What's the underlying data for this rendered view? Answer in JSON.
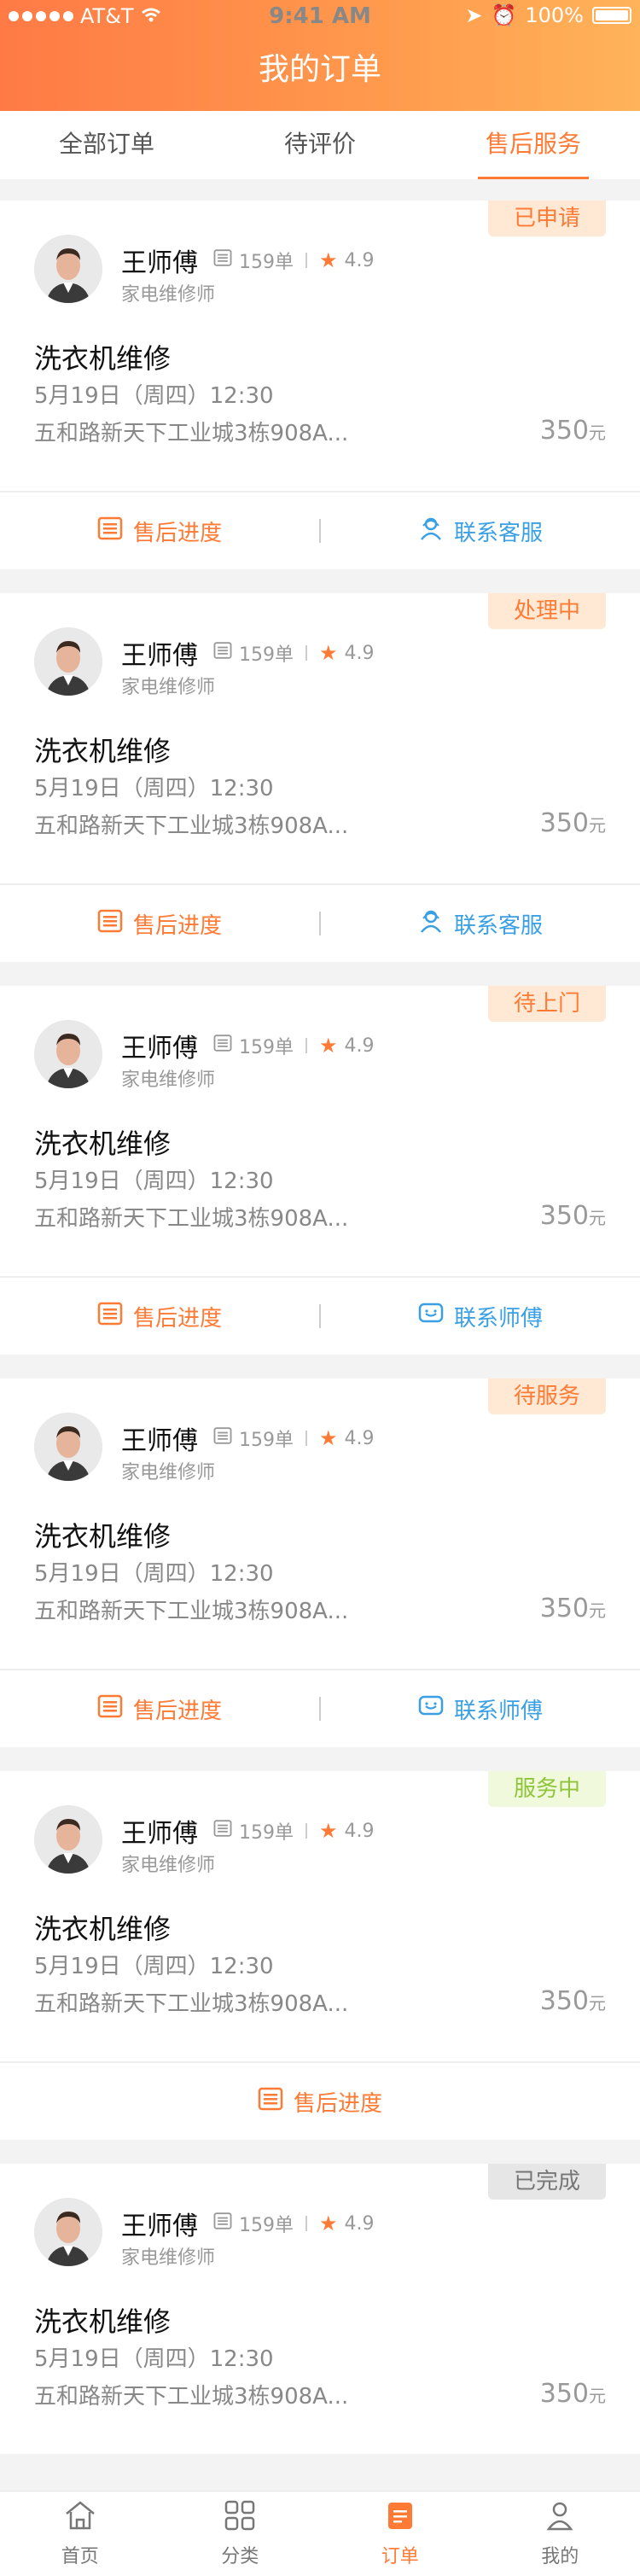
{
  "status_bar": {
    "carrier": "AT&T",
    "time": "9:41 AM",
    "battery": "100%"
  },
  "header": {
    "title": "我的订单"
  },
  "tabs": [
    {
      "label": "全部订单"
    },
    {
      "label": "待评价"
    },
    {
      "label": "售后服务"
    }
  ],
  "cards": [
    {
      "badge": "已申请",
      "name": "王师傅",
      "orders": "159单",
      "rating": "4.9",
      "role": "家电维修师",
      "service": "洗衣机维修",
      "datetime": "5月19日（周四）12:30",
      "address": "五和路新天下工业城3栋908A...",
      "price": "350",
      "unit": "元",
      "actions": [
        {
          "label": "售后进度"
        },
        {
          "label": "联系客服"
        }
      ]
    },
    {
      "badge": "处理中",
      "name": "王师傅",
      "orders": "159单",
      "rating": "4.9",
      "role": "家电维修师",
      "service": "洗衣机维修",
      "datetime": "5月19日（周四）12:30",
      "address": "五和路新天下工业城3栋908A...",
      "price": "350",
      "unit": "元",
      "actions": [
        {
          "label": "售后进度"
        },
        {
          "label": "联系客服"
        }
      ]
    },
    {
      "badge": "待上门",
      "name": "王师傅",
      "orders": "159单",
      "rating": "4.9",
      "role": "家电维修师",
      "service": "洗衣机维修",
      "datetime": "5月19日（周四）12:30",
      "address": "五和路新天下工业城3栋908A...",
      "price": "350",
      "unit": "元",
      "actions": [
        {
          "label": "售后进度"
        },
        {
          "label": "联系师傅"
        }
      ]
    },
    {
      "badge": "待服务",
      "name": "王师傅",
      "orders": "159单",
      "rating": "4.9",
      "role": "家电维修师",
      "service": "洗衣机维修",
      "datetime": "5月19日（周四）12:30",
      "address": "五和路新天下工业城3栋908A...",
      "price": "350",
      "unit": "元",
      "actions": [
        {
          "label": "售后进度"
        },
        {
          "label": "联系师傅"
        }
      ]
    },
    {
      "badge": "服务中",
      "name": "王师傅",
      "orders": "159单",
      "rating": "4.9",
      "role": "家电维修师",
      "service": "洗衣机维修",
      "datetime": "5月19日（周四）12:30",
      "address": "五和路新天下工业城3栋908A...",
      "price": "350",
      "unit": "元",
      "actions": [
        {
          "label": "售后进度"
        }
      ]
    },
    {
      "badge": "已完成",
      "name": "王师傅",
      "orders": "159单",
      "rating": "4.9",
      "role": "家电维修师",
      "service": "洗衣机维修",
      "datetime": "5月19日（周四）12:30",
      "address": "五和路新天下工业城3栋908A...",
      "price": "350",
      "unit": "元",
      "actions": []
    }
  ],
  "bottom_nav": [
    {
      "label": "首页",
      "icon": "home-icon"
    },
    {
      "label": "分类",
      "icon": "category-icon"
    },
    {
      "label": "订单",
      "icon": "order-icon"
    },
    {
      "label": "我的",
      "icon": "profile-icon"
    }
  ]
}
